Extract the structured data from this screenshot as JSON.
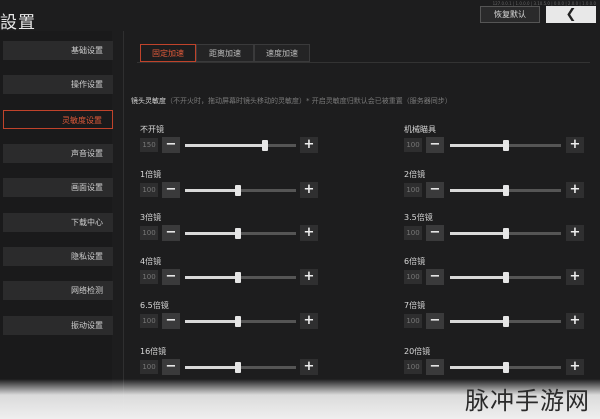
{
  "header": {
    "title": "設置",
    "top_info": "127.0.0.1 | 1.0.0.0 | 3.10.5.0 | 0.0.0 | 2.0.0 | 1.0.0.0",
    "reset_label": "恢复默认",
    "back_icon": "chevron-left-icon"
  },
  "sidebar": {
    "items": [
      {
        "label": "基础设置"
      },
      {
        "label": "操作设置"
      },
      {
        "label": "灵敏度设置"
      },
      {
        "label": "声音设置"
      },
      {
        "label": "画面设置"
      },
      {
        "label": "下载中心"
      },
      {
        "label": "隐私设置"
      },
      {
        "label": "网络检测"
      },
      {
        "label": "振动设置"
      }
    ],
    "active_index": 2
  },
  "tabs": [
    {
      "label": "固定加速"
    },
    {
      "label": "距离加速"
    },
    {
      "label": "速度加速"
    }
  ],
  "section": {
    "title": "镜头灵敏度",
    "note": "（不开火时，拖动屏幕时镜头移动的灵敏度）* 开启灵敏度归默认会已被重置（服务器同步）"
  },
  "scopes": [
    {
      "label": "不开镜",
      "value": "150",
      "level": 0.72
    },
    {
      "label": "机械瞄具",
      "value": "100",
      "level": 0.5
    },
    {
      "label": "1倍镜",
      "value": "100",
      "level": 0.48
    },
    {
      "label": "2倍镜",
      "value": "100",
      "level": 0.5
    },
    {
      "label": "3倍镜",
      "value": "100",
      "level": 0.48
    },
    {
      "label": "3.5倍镜",
      "value": "100",
      "level": 0.5
    },
    {
      "label": "4倍镜",
      "value": "100",
      "level": 0.48
    },
    {
      "label": "6倍镜",
      "value": "100",
      "level": 0.5
    },
    {
      "label": "6.5倍镜",
      "value": "100",
      "level": 0.48
    },
    {
      "label": "7倍镜",
      "value": "100",
      "level": 0.5
    },
    {
      "label": "16倍镜",
      "value": "100",
      "level": 0.48
    },
    {
      "label": "20倍镜",
      "value": "100",
      "level": 0.5
    }
  ],
  "watermark": "脉冲手游网",
  "colors": {
    "accent": "#e05a3a",
    "background": "#1d1d1e"
  }
}
